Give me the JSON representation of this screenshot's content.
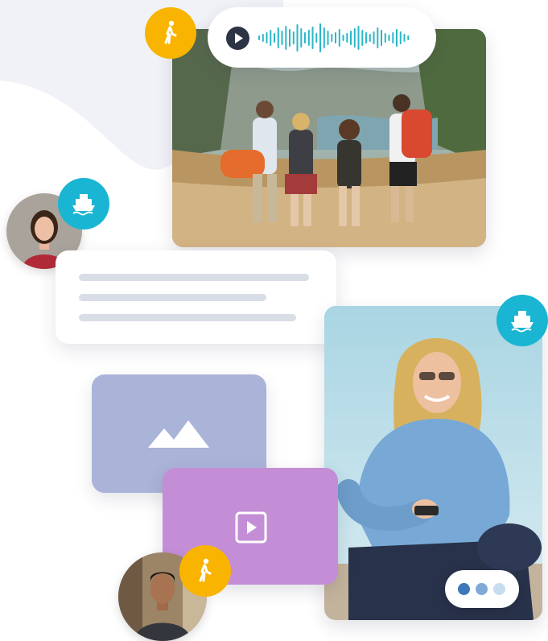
{
  "audio_message": {
    "play_icon": "play-icon",
    "waveform_icon": "audio-waveform"
  },
  "badges": {
    "walking": {
      "icon": "walking-icon",
      "color": "#f8b400"
    },
    "ferry": {
      "icon": "ferry-icon",
      "color": "#19b5d2"
    }
  },
  "tiles": {
    "image_placeholder": {
      "icon": "mountains-icon",
      "color": "#aab3d8"
    },
    "video_placeholder": {
      "icon": "play-square-icon",
      "color": "#c38ed6"
    }
  },
  "typing_indicator": {
    "dot_colors": [
      "#3c78b8",
      "#7fa9d6",
      "#c8dcef"
    ]
  }
}
